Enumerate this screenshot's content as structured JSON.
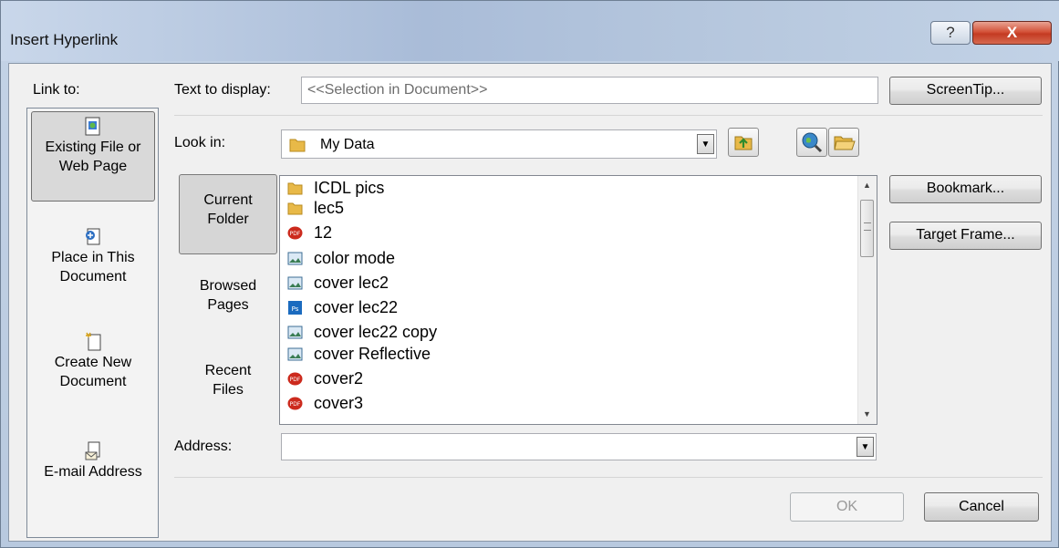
{
  "window": {
    "title": "Insert Hyperlink",
    "help_symbol": "?",
    "close_symbol": "X"
  },
  "link_to": {
    "label": "Link to:",
    "items": [
      {
        "line1": "Existing File or",
        "line2": "Web Page",
        "icon": "existing-file-icon",
        "selected": true
      },
      {
        "line1": "Place in This",
        "line2": "Document",
        "icon": "place-in-document-icon"
      },
      {
        "line1": "Create New",
        "line2": "Document",
        "icon": "create-document-icon"
      },
      {
        "line1": "E-mail Address",
        "line2": "",
        "icon": "email-address-icon"
      }
    ]
  },
  "text_to_display": {
    "label": "Text to display:",
    "value": "<<Selection in Document>>"
  },
  "screentip_label": "ScreenTip...",
  "look_in": {
    "label": "Look in:",
    "value": "My Data"
  },
  "places": [
    {
      "line1": "Current",
      "line2": "Folder",
      "selected": true
    },
    {
      "line1": "Browsed",
      "line2": "Pages"
    },
    {
      "line1": "Recent",
      "line2": "Files"
    }
  ],
  "files": [
    {
      "name": "ICDL pics",
      "type": "folder"
    },
    {
      "name": "lec5",
      "type": "folder"
    },
    {
      "name": "12",
      "type": "pdf"
    },
    {
      "name": "color mode",
      "type": "image"
    },
    {
      "name": "cover lec2",
      "type": "image"
    },
    {
      "name": "cover lec22",
      "type": "psd"
    },
    {
      "name": "cover lec22 copy",
      "type": "image"
    },
    {
      "name": "cover Reflective",
      "type": "image"
    },
    {
      "name": "cover2",
      "type": "pdf"
    },
    {
      "name": "cover3",
      "type": "pdf"
    }
  ],
  "bookmark_label": "Bookmark...",
  "target_frame_label": "Target Frame...",
  "address": {
    "label": "Address:",
    "value": ""
  },
  "ok_label": "OK",
  "cancel_label": "Cancel",
  "colors": {
    "accent_close": "#c43a22",
    "title_bg": "#b7c8de",
    "folder": "#e8b948",
    "pdf": "#cc2a1d",
    "psd": "#1b6bbf"
  }
}
